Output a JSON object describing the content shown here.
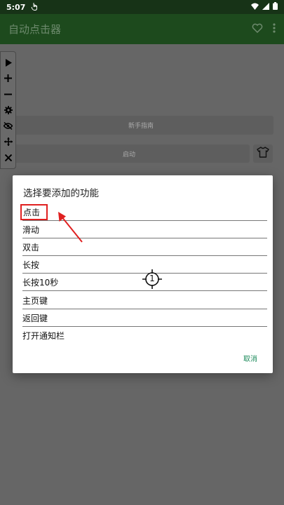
{
  "status_bar": {
    "time": "5:07"
  },
  "app_bar": {
    "title": "自动点击器"
  },
  "floating_toolbar": {
    "buttons": [
      "play-icon",
      "plus-icon",
      "minus-icon",
      "gear-icon",
      "eye-off-icon",
      "move-icon",
      "close-icon"
    ]
  },
  "background": {
    "guide_button": "新手指南",
    "start_button": "启动"
  },
  "dialog": {
    "title": "选择要添加的功能",
    "options": [
      "点击",
      "滑动",
      "双击",
      "长按",
      "长按10秒",
      "主页键",
      "返回键",
      "打开通知栏"
    ],
    "cancel": "取消"
  },
  "crosshair": {
    "label": "1"
  },
  "colors": {
    "app_bar": "#1d4a1d",
    "status_bar": "#173317",
    "accent": "#1b8a5a",
    "highlight": "#e02020"
  }
}
